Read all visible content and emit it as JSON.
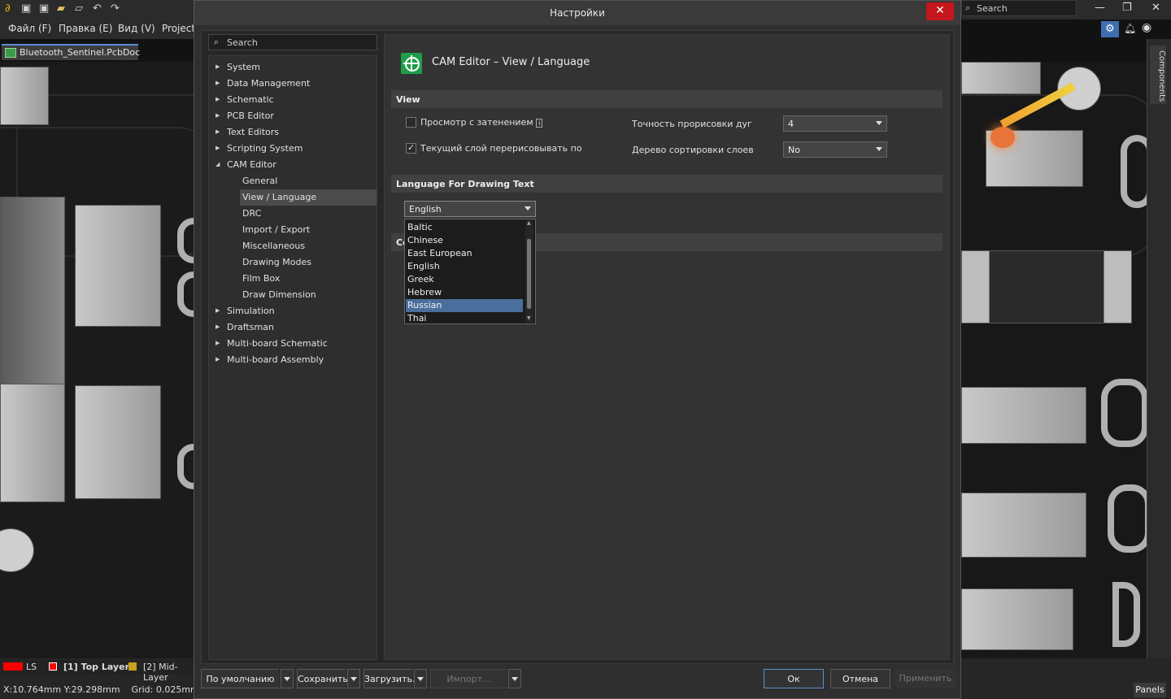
{
  "app": {
    "menu": [
      "Файл (F)",
      "Правка (E)",
      "Вид (V)",
      "Project"
    ],
    "doc_tab": "Bluetooth_Sentinel.PcbDoc",
    "search_placeholder": "Search",
    "components_tab": "Components",
    "panels_button": "Panels"
  },
  "status": {
    "layers": [
      {
        "label": "LS",
        "color": "#ff0000"
      },
      {
        "label": "[1] Top Layer",
        "color": "#ff0000"
      },
      {
        "label": "[2] Mid-Layer",
        "color": "#c8a020"
      }
    ],
    "coords": "X:10.764mm Y:29.298mm",
    "grid": "Grid: 0.025mm"
  },
  "dialog": {
    "title": "Настройки",
    "tree_search": "Search",
    "tree": [
      {
        "label": "System",
        "level": 0,
        "arrow": "▶"
      },
      {
        "label": "Data Management",
        "level": 0,
        "arrow": "▶"
      },
      {
        "label": "Schematic",
        "level": 0,
        "arrow": "▶"
      },
      {
        "label": "PCB Editor",
        "level": 0,
        "arrow": "▶"
      },
      {
        "label": "Text Editors",
        "level": 0,
        "arrow": "▶"
      },
      {
        "label": "Scripting System",
        "level": 0,
        "arrow": "▶"
      },
      {
        "label": "CAM Editor",
        "level": 0,
        "arrow": "◢"
      },
      {
        "label": "General",
        "level": 1
      },
      {
        "label": "View / Language",
        "level": 1,
        "selected": true
      },
      {
        "label": "DRC",
        "level": 1
      },
      {
        "label": "Import / Export",
        "level": 1
      },
      {
        "label": "Miscellaneous",
        "level": 1
      },
      {
        "label": "Drawing Modes",
        "level": 1
      },
      {
        "label": "Film Box",
        "level": 1
      },
      {
        "label": "Draw Dimension",
        "level": 1
      },
      {
        "label": "Simulation",
        "level": 0,
        "arrow": "▶"
      },
      {
        "label": "Draftsman",
        "level": 0,
        "arrow": "▶"
      },
      {
        "label": "Multi-board Schematic",
        "level": 0,
        "arrow": "▶"
      },
      {
        "label": "Multi-board Assembly",
        "level": 0,
        "arrow": "▶"
      }
    ],
    "page_title": "CAM Editor – View / Language",
    "view_section": "View",
    "opt_shading": {
      "label": "Просмотр с затенением",
      "checked": false
    },
    "opt_redraw": {
      "label": "Текущий слой перерисовывать по",
      "checked": true
    },
    "arc_precision": {
      "label": "Точность прорисовки дуг",
      "value": "4"
    },
    "layer_tree": {
      "label": "Дерево сортировки слоев",
      "value": "No"
    },
    "language_section": "Language For Drawing Text",
    "language_value": "English",
    "language_options": [
      "Baltic",
      "Chinese",
      "East European",
      "English",
      "Greek",
      "Hebrew",
      "Russian",
      "Thai"
    ],
    "language_highlighted": "Russian",
    "hidden_section_stub": "Co",
    "footer": {
      "defaults": "По умолчанию",
      "save": "Сохранить...",
      "load": "Загрузить...",
      "import": "Импорт...",
      "ok": "Ок",
      "cancel": "Отмена",
      "apply": "Применить"
    }
  },
  "colors": {
    "accent": "#5b8ed0",
    "close": "#c4161c",
    "selection": "#4a6f9c"
  }
}
